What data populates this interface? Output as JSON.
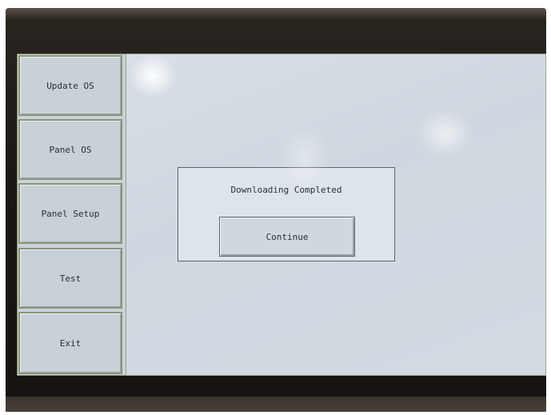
{
  "sidebar": {
    "items": [
      {
        "label": "Update OS"
      },
      {
        "label": "Panel OS"
      },
      {
        "label": "Panel Setup"
      },
      {
        "label": "Test"
      },
      {
        "label": "Exit"
      }
    ]
  },
  "dialog": {
    "message": "Downloading Completed",
    "button_label": "Continue"
  },
  "colors": {
    "screen_background": "#c9d2da",
    "button_face": "#c8d0d8",
    "bezel": "#1b1714",
    "text": "#2a2f36"
  }
}
